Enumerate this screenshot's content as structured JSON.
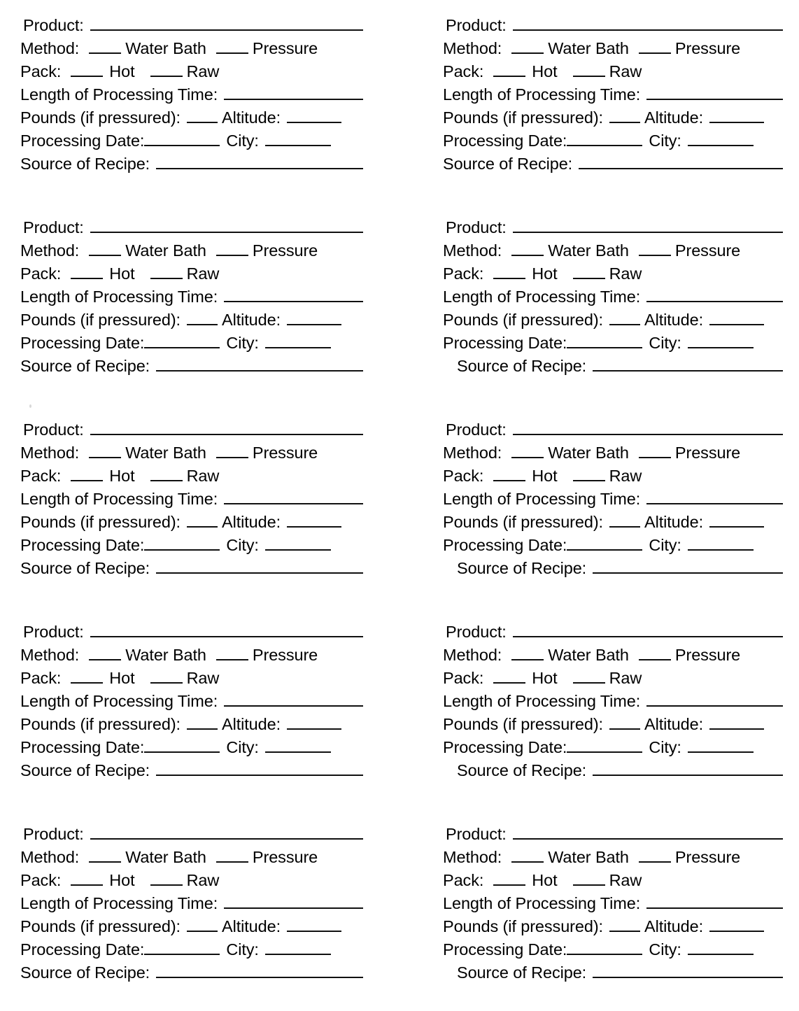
{
  "document": {
    "kind": "home-canning-jar-label-sheet",
    "columns": 2,
    "rows": 5,
    "total_labels": 10
  },
  "fields": {
    "product": "Product:",
    "method": "Method:",
    "water_bath": "Water Bath",
    "pressure": "Pressure",
    "pack": "Pack:",
    "hot": "Hot",
    "raw": "Raw",
    "processing_time": "Length of Processing Time:",
    "pounds": "Pounds (if pressured):",
    "altitude": "Altitude:",
    "processing_date": "Processing Date:",
    "city": "City:",
    "source_of_recipe": "Source of Recipe:"
  },
  "labels": [
    {
      "id": "label-1",
      "column": "left",
      "row": 1,
      "source_indented": false
    },
    {
      "id": "label-2",
      "column": "right",
      "row": 1,
      "source_indented": false
    },
    {
      "id": "label-3",
      "column": "left",
      "row": 2,
      "source_indented": false
    },
    {
      "id": "label-4",
      "column": "right",
      "row": 2,
      "source_indented": true
    },
    {
      "id": "label-5",
      "column": "left",
      "row": 3,
      "source_indented": false
    },
    {
      "id": "label-6",
      "column": "right",
      "row": 3,
      "source_indented": true
    },
    {
      "id": "label-7",
      "column": "left",
      "row": 4,
      "source_indented": false
    },
    {
      "id": "label-8",
      "column": "right",
      "row": 4,
      "source_indented": true
    },
    {
      "id": "label-9",
      "column": "left",
      "row": 5,
      "source_indented": false
    },
    {
      "id": "label-10",
      "column": "right",
      "row": 5,
      "source_indented": true
    }
  ],
  "colors": {
    "ink": "#111111",
    "paper": "#ffffff"
  }
}
